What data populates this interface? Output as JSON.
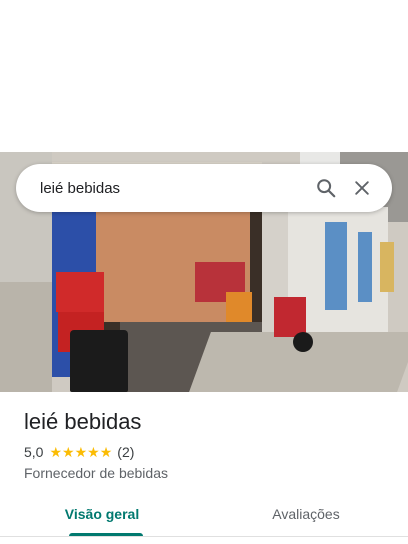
{
  "search": {
    "query": "leié bebidas"
  },
  "icons": {
    "search": "search-icon",
    "close": "close-icon",
    "star": "star-icon"
  },
  "place": {
    "name": "leié bebidas",
    "rating": "5,0",
    "stars": 5,
    "review_count": "(2)",
    "category": "Fornecedor de bebidas"
  },
  "tabs": [
    {
      "label": "Visão geral",
      "selected": true
    },
    {
      "label": "Avaliações",
      "selected": false
    }
  ],
  "colors": {
    "accent": "#01796f",
    "star": "#fbbc04"
  }
}
